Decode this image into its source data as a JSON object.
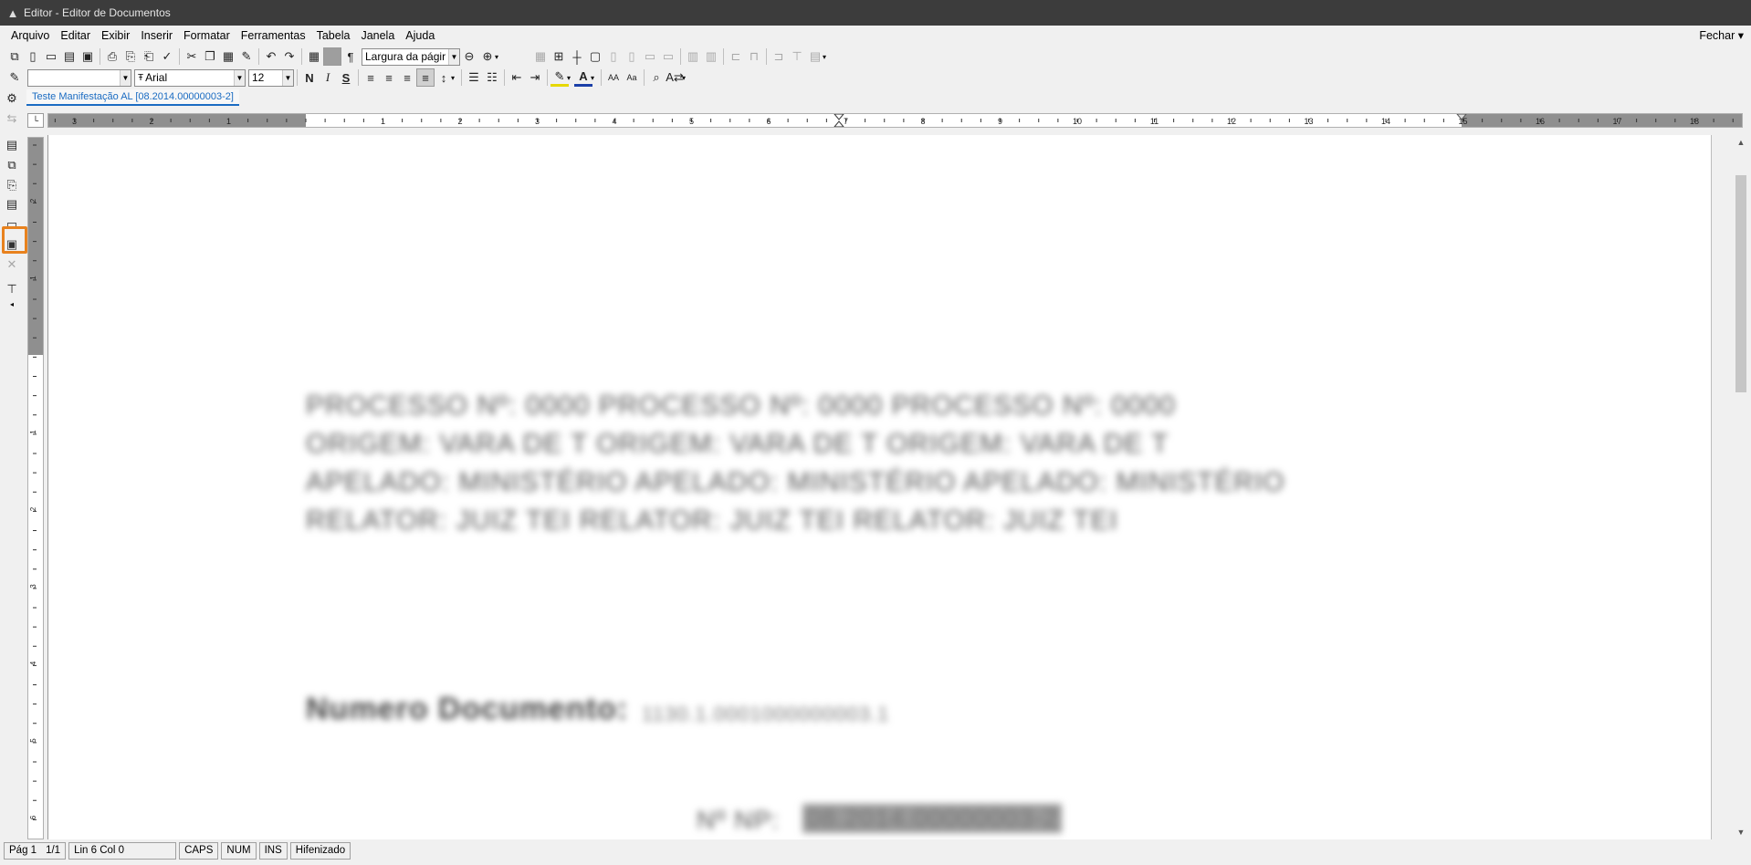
{
  "window": {
    "title": "Editor - Editor de Documentos"
  },
  "menu": {
    "items": [
      "Arquivo",
      "Editar",
      "Exibir",
      "Inserir",
      "Formatar",
      "Ferramentas",
      "Tabela",
      "Janela",
      "Ajuda"
    ],
    "close_label": "Fechar"
  },
  "toolbar": {
    "zoom_value": "Largura da págir",
    "style_value": "",
    "font_value": "Arial",
    "size_value": "12",
    "bold": "N",
    "italic": "I",
    "strike": "S"
  },
  "document": {
    "tab_label": "Teste Manifestação AL [08.2014.00000003-2]",
    "lines": [
      "PROCESSO Nº: 0000 PROCESSO Nº: 0000 PROCESSO Nº: 0000",
      "ORIGEM: VARA DE T ORIGEM: VARA DE T ORIGEM: VARA DE T",
      "APELADO: MINISTÉRIO APELADO: MINISTÉRIO APELADO: MINISTÉRIO",
      "RELATOR: JUIZ TEI RELATOR: JUIZ TEI RELATOR: JUIZ TEI"
    ],
    "numero_label": "Numero Documento:",
    "numero_value": "1130.1.0001000000003.1",
    "np_label": "Nº NP:",
    "np_value": "08.2014.00000003-2"
  },
  "ruler": {
    "labels": [
      "3",
      "2",
      "1",
      "1",
      "2",
      "3",
      "4",
      "5",
      "6",
      "7",
      "8",
      "9",
      "10",
      "11",
      "12",
      "13",
      "14",
      "15",
      "16",
      "17",
      "18"
    ],
    "vlabels": [
      "2",
      "1",
      "1",
      "2",
      "3",
      "4",
      "5",
      "6"
    ]
  },
  "status": {
    "page": "Pág 1",
    "pages": "1/1",
    "position": "Lin 6  Col 0",
    "caps": "CAPS",
    "num": "NUM",
    "ins": "INS",
    "hyphen": "Hifenizado"
  }
}
